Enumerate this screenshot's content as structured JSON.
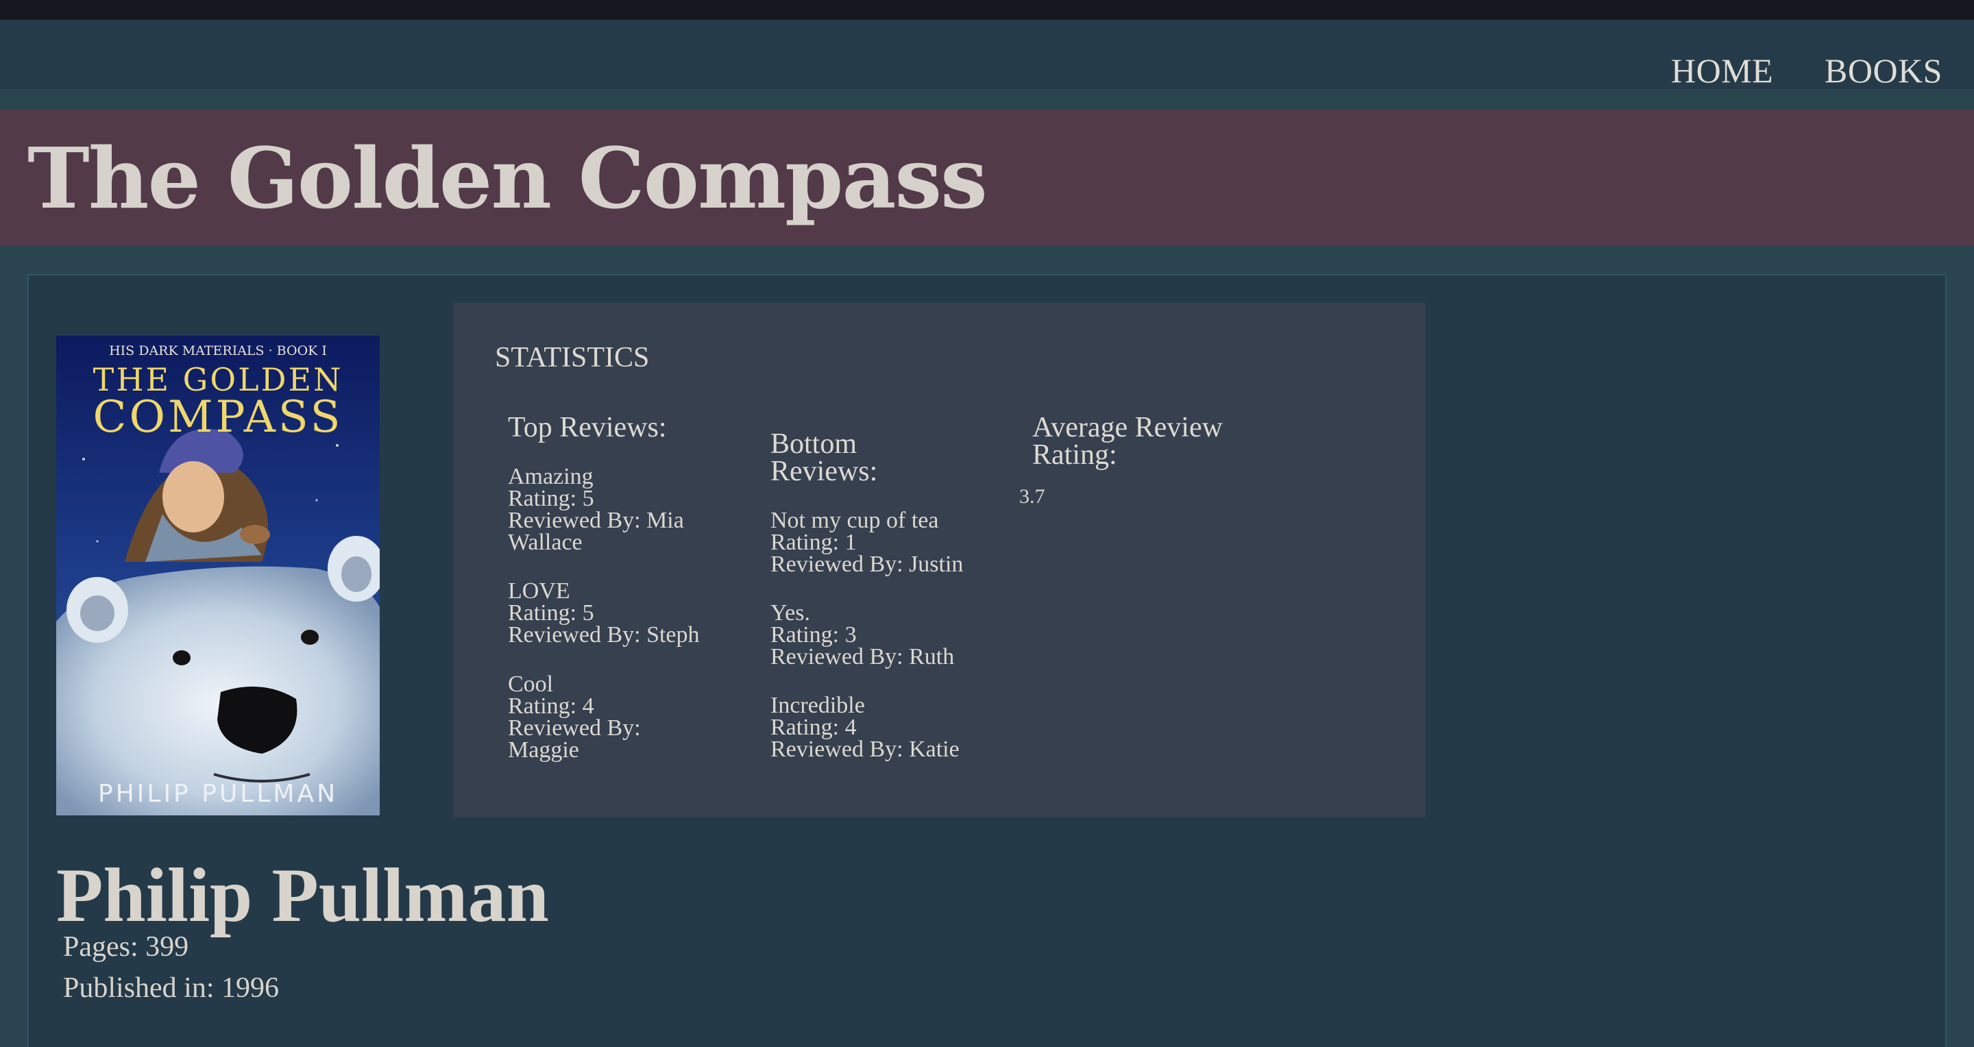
{
  "nav": {
    "home_label": "HOME",
    "books_label": "BOOKS"
  },
  "book": {
    "title": "The Golden Compass",
    "author": "Philip Pullman",
    "pages_text": "Pages: 399",
    "published_text": "Published in: 1996",
    "cover": {
      "series_line": "HIS DARK MATERIALS · BOOK I",
      "title_line_1": "THE GOLDEN",
      "title_line_2": "COMPASS",
      "author_line": "PHILIP PULLMAN"
    }
  },
  "statistics": {
    "heading": "STATISTICS",
    "top_heading": "Top Reviews:",
    "bottom_heading_1": "Bottom",
    "bottom_heading_2": "Reviews:",
    "average_heading_1": "Average Review",
    "average_heading_2": "Rating:",
    "average_value": "3.7",
    "top_reviews": [
      {
        "title": "Amazing",
        "rating": "Rating: 5",
        "by_1": "Reviewed By: Mia",
        "by_2": "Wallace"
      },
      {
        "title": "LOVE",
        "rating": "Rating: 5",
        "by_1": "Reviewed By: Steph",
        "by_2": ""
      },
      {
        "title": "Cool",
        "rating": "Rating: 4",
        "by_1": "Reviewed By:",
        "by_2": "Maggie"
      }
    ],
    "bottom_reviews": [
      {
        "title": "Not my cup of tea",
        "rating": "Rating: 1",
        "by_1": "Reviewed By: Justin"
      },
      {
        "title": "Yes.",
        "rating": "Rating: 3",
        "by_1": "Reviewed By: Ruth"
      },
      {
        "title": "Incredible",
        "rating": "Rating: 4",
        "by_1": "Reviewed By: Katie"
      }
    ]
  },
  "colors": {
    "nav_bg": "#253b49",
    "title_band": "#523a49",
    "panel_bg": "#243a49",
    "stats_bg": "#36404f",
    "text": "#d8d4cc"
  }
}
